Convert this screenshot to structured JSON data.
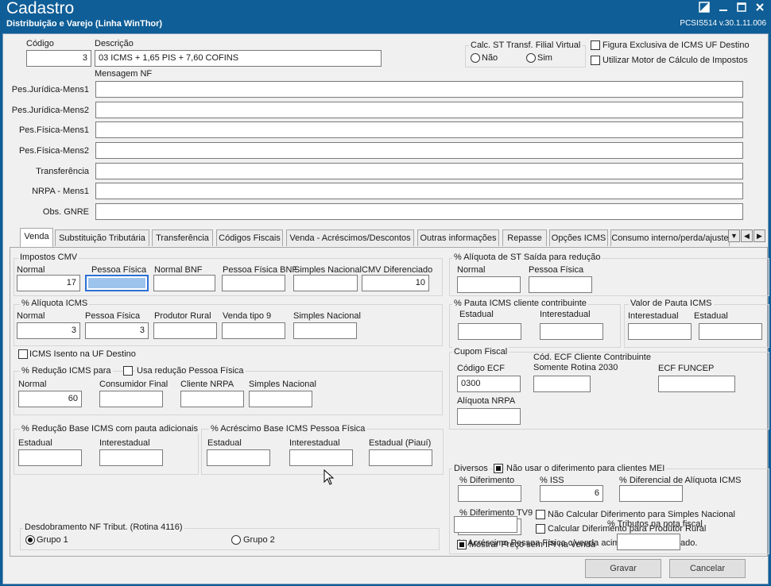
{
  "window": {
    "title": "Cadastro",
    "subtitle": "Distribuição e Varejo (Linha WinThor)",
    "version": "PCSIS514  v.30.1.11.006"
  },
  "header": {
    "codigo_label": "Código",
    "codigo_value": "3",
    "descricao_label": "Descrição",
    "descricao_value": "03 ICMS + 1,65 PIS + 7,60 COFINS",
    "calc_st_label": "Calc. ST Transf. Filial Virtual",
    "radio_nao": "Não",
    "radio_sim": "Sim",
    "figura_exclusiva": "Figura Exclusiva de ICMS UF Destino",
    "utilizar_motor": "Utilizar Motor de Cálculo de Impostos",
    "mensagem_nf": "Mensagem NF"
  },
  "messages": [
    {
      "label": "Pes.Jurídica-Mens1",
      "value": ""
    },
    {
      "label": "Pes.Jurídica-Mens2",
      "value": ""
    },
    {
      "label": "Pes.Física-Mens1",
      "value": ""
    },
    {
      "label": "Pes.Física-Mens2",
      "value": ""
    },
    {
      "label": "Transferência",
      "value": ""
    },
    {
      "label": "NRPA - Mens1",
      "value": ""
    },
    {
      "label": "Obs. GNRE",
      "value": ""
    }
  ],
  "tabs": [
    "Venda",
    "Substituição Tributária",
    "Transferência",
    "Códigos Fiscais",
    "Venda - Acréscimos/Descontos",
    "Outras informações",
    "Repasse",
    "Opções ICMS",
    "Consumo interno/perda/ajuste"
  ],
  "impostos_cmv": {
    "title": "Impostos CMV",
    "normal_label": "Normal",
    "normal_value": "17",
    "pf_label": "Pessoa Física",
    "pf_value": "",
    "normal_bnf_label": "Normal BNF",
    "normal_bnf_value": "",
    "pf_bnf_label": "Pessoa Física BNF",
    "pf_bnf_value": "",
    "simples_label": "Simples Nacional",
    "simples_value": "",
    "cmv_dif_label": "CMV Diferenciado",
    "cmv_dif_value": "10"
  },
  "aliquota_icms": {
    "title": "% Alíquota ICMS",
    "normal_label": "Normal",
    "normal_value": "3",
    "pf_label": "Pessoa Física",
    "pf_value": "3",
    "produtor_label": "Produtor Rural",
    "produtor_value": "",
    "venda9_label": "Venda tipo 9",
    "venda9_value": "",
    "simples_label": "Simples Nacional",
    "simples_value": ""
  },
  "icms_isento": "ICMS Isento na UF Destino",
  "reducao_icms": {
    "title": "% Redução ICMS para",
    "usa_reducao": "Usa redução Pessoa Física",
    "normal_label": "Normal",
    "normal_value": "60",
    "consumidor_label": "Consumidor Final",
    "consumidor_value": "",
    "cliente_nrpa_label": "Cliente NRPA",
    "cliente_nrpa_value": "",
    "simples_label": "Simples Nacional",
    "simples_value": ""
  },
  "reducao_base": {
    "title": "% Redução Base ICMS com pauta adicionais",
    "estadual_label": "Estadual",
    "interestadual_label": "Interestadual"
  },
  "acrescimo_base": {
    "title": "% Acréscimo Base ICMS Pessoa Física",
    "estadual_label": "Estadual",
    "interestadual_label": "Interestadual",
    "piaui_label": "Estadual (Piauí)"
  },
  "desdobramento": {
    "title": "Desdobramento NF Tribut. (Rotina 4116)",
    "grupo1": "Grupo 1",
    "grupo2": "Grupo 2"
  },
  "aliquota_st_saida": {
    "title": "% Alíquota de ST Saída para redução",
    "normal_label": "Normal",
    "pf_label": "Pessoa Física"
  },
  "pauta_icms": {
    "title": "% Pauta ICMS cliente contribuinte",
    "estadual_label": "Estadual",
    "interestadual_label": "Interestadual"
  },
  "valor_pauta": {
    "title": "Valor de Pauta ICMS",
    "interestadual_label": "Interestadual",
    "estadual_label": "Estadual"
  },
  "cupom_fiscal": {
    "title": "Cupom Fiscal",
    "codigo_ecf_label": "Código ECF",
    "codigo_ecf_value": "0300",
    "cod_cliente_label_1": "Cód. ECF Cliente Contribuinte",
    "cod_cliente_label_2": "Somente Rotina 2030",
    "funcep_label": "ECF FUNCEP",
    "aliquota_nrpa_label": "Alíquota NRPA"
  },
  "diversos": {
    "title": "Diversos",
    "nao_usar_diferimento": "Não usar o diferimento para clientes MEI",
    "diferimento_label": "% Diferimento",
    "iss_label": "% ISS",
    "iss_value": "6",
    "diferencial_label": "% Diferencial de Alíquota ICMS",
    "diferimento_tv9_label": "% Diferimento TV9",
    "nao_calcular_simples": "Não Calcular Diferimento para Simples Nacional",
    "calcular_produtor": "Calcular Diferimento para Produtor Rural",
    "acrescimo_pf_label": "% Acréscimo Pessoa Física c/venda acima do parametrizado.",
    "tributos_nota_label": "% Tributos na nota fiscal",
    "mostrar_preco": "Mostrar Preço sem IPI na Venda"
  },
  "footer": {
    "gravar": "Gravar",
    "cancelar": "Cancelar"
  }
}
